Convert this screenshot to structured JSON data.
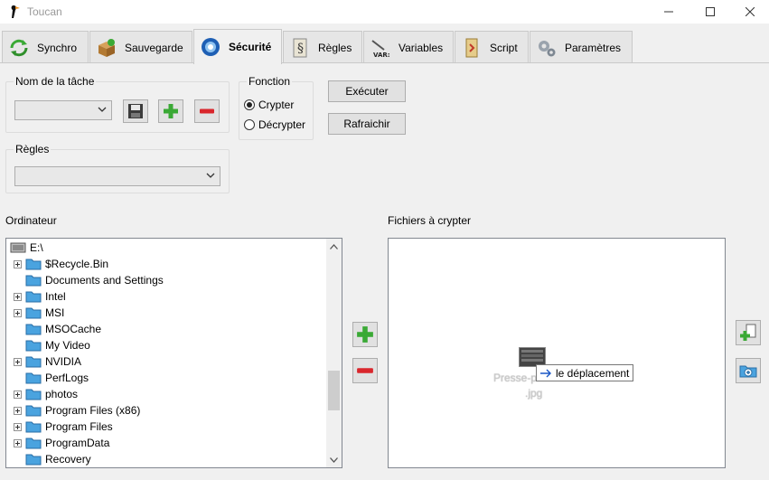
{
  "window": {
    "title": "Toucan"
  },
  "tabs": [
    {
      "label": "Synchro",
      "icon": "sync-icon"
    },
    {
      "label": "Sauvegarde",
      "icon": "backup-box-icon"
    },
    {
      "label": "Sécurité",
      "icon": "shield-icon",
      "active": true
    },
    {
      "label": "Règles",
      "icon": "rules-doc-icon"
    },
    {
      "label": "Variables",
      "icon": "variables-icon"
    },
    {
      "label": "Script",
      "icon": "script-icon"
    },
    {
      "label": "Paramètres",
      "icon": "gears-icon"
    }
  ],
  "task": {
    "legend": "Nom de la tâche",
    "value": ""
  },
  "rules": {
    "legend": "Règles",
    "value": ""
  },
  "function": {
    "legend": "Fonction",
    "options": [
      "Crypter",
      "Décrypter"
    ],
    "selected": "Crypter"
  },
  "actions": {
    "execute_label": "Exécuter",
    "refresh_label": "Rafraichir"
  },
  "computer": {
    "label": "Ordinateur",
    "root": "E:\\",
    "folders": [
      {
        "name": "$Recycle.Bin",
        "expandable": true
      },
      {
        "name": "Documents and Settings",
        "expandable": false
      },
      {
        "name": "Intel",
        "expandable": true
      },
      {
        "name": "MSI",
        "expandable": true
      },
      {
        "name": "MSOCache",
        "expandable": false
      },
      {
        "name": "My Video",
        "expandable": false
      },
      {
        "name": "NVIDIA",
        "expandable": true
      },
      {
        "name": "PerfLogs",
        "expandable": false
      },
      {
        "name": "photos",
        "expandable": true
      },
      {
        "name": "Program Files (x86)",
        "expandable": true
      },
      {
        "name": "Program Files",
        "expandable": true
      },
      {
        "name": "ProgramData",
        "expandable": true
      },
      {
        "name": "Recovery",
        "expandable": false
      }
    ]
  },
  "files": {
    "label": "Fichiers à crypter",
    "drag_file_line1": "Presse-p",
    "drag_file_line2": ".jpg",
    "drag_tooltip": "le déplacement"
  },
  "colors": {
    "accent_green": "#3aa935",
    "accent_red": "#d9262c",
    "folder_blue": "#4aa3df"
  }
}
